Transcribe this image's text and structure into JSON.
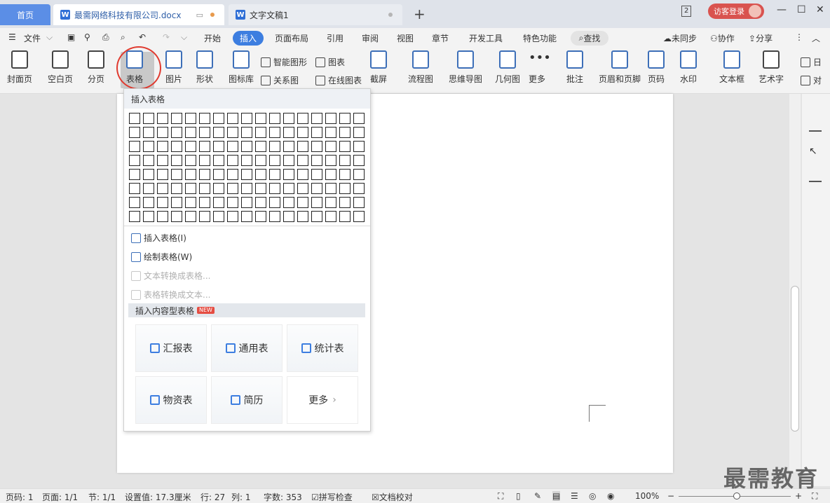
{
  "tabs": {
    "home": "首页",
    "doc1": "最需网络科技有限公司.docx",
    "doc2": "文字文稿1"
  },
  "titlebar": {
    "window_count": "2",
    "login": "访客登录"
  },
  "menu": {
    "file": "文件",
    "items": [
      "开始",
      "插入",
      "页面布局",
      "引用",
      "审阅",
      "视图",
      "章节",
      "开发工具",
      "特色功能"
    ],
    "search": "查找",
    "sync": "未同步",
    "collab": "协作",
    "share": "分享"
  },
  "ribbon": {
    "cover": "封面页",
    "blank": "空白页",
    "pagebreak": "分页",
    "table": "表格",
    "picture": "图片",
    "shape": "形状",
    "iconlib": "图标库",
    "smartart": "智能图形",
    "relation": "关系图",
    "chart": "图表",
    "onlinechart": "在线图表",
    "screenshot": "截屏",
    "flowchart": "流程图",
    "mindmap": "思维导图",
    "geometry": "几何图",
    "more": "更多",
    "comment": "批注",
    "headerfooter": "页眉和页脚",
    "pagenum": "页码",
    "watermark": "水印",
    "textbox": "文本框",
    "wordart": "艺术字",
    "date": "日",
    "obj": "对"
  },
  "dropdown": {
    "header": "插入表格",
    "insert_table": "插入表格(I)",
    "draw_table": "绘制表格(W)",
    "text_to_table": "文本转换成表格...",
    "table_to_text": "表格转换成文本...",
    "content_header": "插入内容型表格",
    "new_badge": "NEW",
    "cards": [
      "汇报表",
      "通用表",
      "统计表",
      "物资表",
      "简历",
      "更多"
    ]
  },
  "status": {
    "page": "页码: 1",
    "pages": "页面: 1/1",
    "section": "节: 1/1",
    "setting": "设置值: 17.3厘米",
    "row": "行: 27",
    "col": "列: 1",
    "words": "字数: 353",
    "spell": "拼写检查",
    "proof": "文档校对",
    "zoom": "100%"
  },
  "watermark": "最需教育"
}
